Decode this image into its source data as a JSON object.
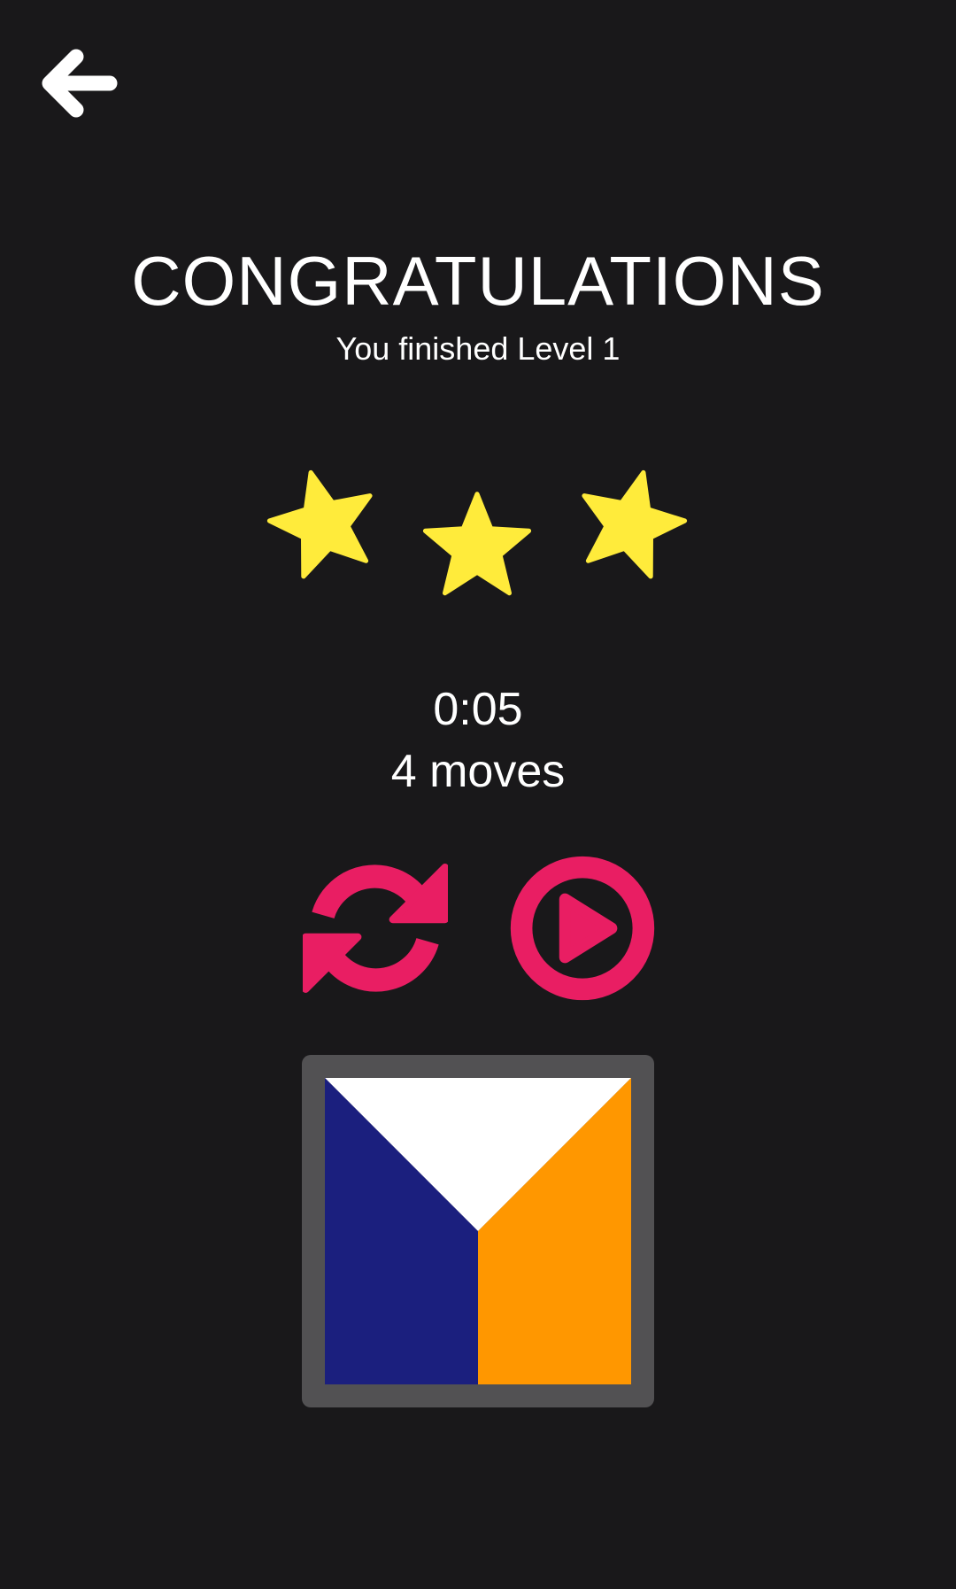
{
  "header": {
    "back_icon": "arrow-left-icon"
  },
  "result": {
    "title": "CONGRATULATIONS",
    "subtitle": "You finished Level 1",
    "stars_earned": 3,
    "stars_total": 3,
    "time": "0:05",
    "moves": "4 moves"
  },
  "actions": {
    "restart_icon": "refresh-icon",
    "play_icon": "play-circle-icon"
  },
  "puzzle": {
    "pieces": [
      {
        "name": "top-white-piece",
        "color": "#ffffff"
      },
      {
        "name": "left-navy-piece",
        "color": "#1b1f7e"
      },
      {
        "name": "right-orange-piece",
        "color": "#ff9700"
      }
    ]
  },
  "colors": {
    "background": "#19181a",
    "accent": "#e91e63",
    "star": "#ffeb3b",
    "board_frame": "#525153"
  }
}
